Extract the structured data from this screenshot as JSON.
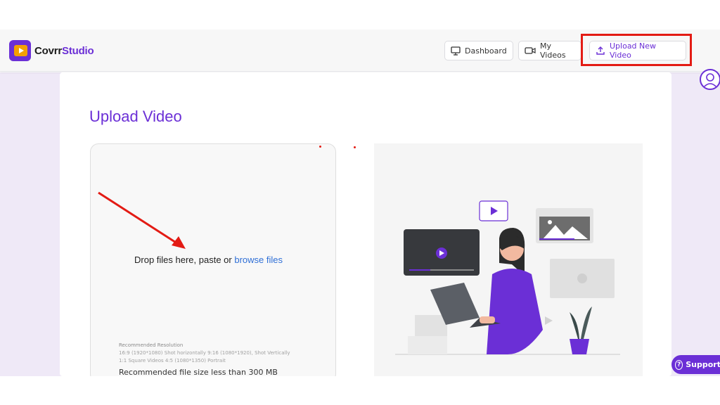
{
  "brand": {
    "name_part1": "Covrr",
    "name_part2": "Studio"
  },
  "nav": {
    "dashboard_label": "Dashboard",
    "myvideos_label": "My Videos",
    "upload_label": "Upload New Video"
  },
  "page": {
    "title": "Upload Video"
  },
  "dropzone": {
    "text_prefix": "Drop files here, paste or ",
    "browse_link": "browse files",
    "recommended_heading": "Recommended Resolution",
    "recommended_line1": "16:9 (1920*1080) Shot horizontally 9:16 (1080*1920), Shot Vertically",
    "recommended_line2": "1:1 Square Videos 4:5 (1080*1350) Portrait",
    "file_size_note": "Recommended file size less than 300 MB"
  },
  "support": {
    "label": "Support",
    "icon_glyph": "?"
  },
  "colors": {
    "brand": "#6b2fd6",
    "logo_accent": "#f4a000",
    "highlight": "#e31b14",
    "link": "#2f6fd6",
    "background": "#efe9f7"
  },
  "icons": {
    "dashboard": "monitor-icon",
    "myvideos": "video-camera-icon",
    "upload": "upload-icon",
    "avatar": "user-avatar-icon",
    "support": "question-icon"
  }
}
